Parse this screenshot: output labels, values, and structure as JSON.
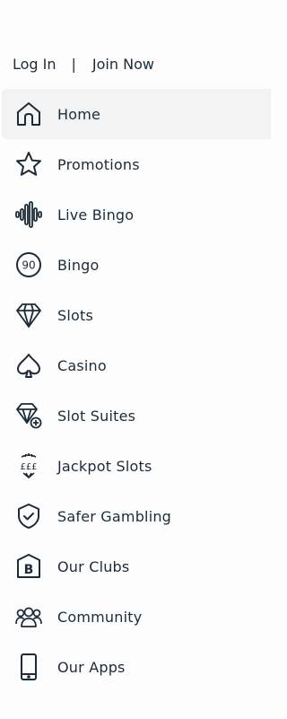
{
  "auth": {
    "login_label": "Log In",
    "separator": "|",
    "join_label": "Join Now"
  },
  "menu": {
    "items": [
      {
        "label": "Home",
        "icon": "home-icon",
        "active": true
      },
      {
        "label": "Promotions",
        "icon": "star-icon"
      },
      {
        "label": "Live Bingo",
        "icon": "soundwave-icon"
      },
      {
        "label": "Bingo",
        "icon": "bingo-ball-90-icon",
        "icon_text": "90"
      },
      {
        "label": "Slots",
        "icon": "diamond-icon"
      },
      {
        "label": "Casino",
        "icon": "spade-icon"
      },
      {
        "label": "Slot Suites",
        "icon": "diamond-plus-icon"
      },
      {
        "label": "Jackpot Slots",
        "icon": "jackpot-pounds-icon",
        "icon_text": "£££"
      },
      {
        "label": "Safer Gambling",
        "icon": "shield-check-icon"
      },
      {
        "label": "Our Clubs",
        "icon": "club-b-icon",
        "icon_text": "B"
      },
      {
        "label": "Community",
        "icon": "people-icon"
      },
      {
        "label": "Our Apps",
        "icon": "phone-icon"
      }
    ]
  },
  "colors": {
    "text": "#1c2b39",
    "active_background": "#f3f3f3",
    "page_background": "#fdfdfd"
  }
}
